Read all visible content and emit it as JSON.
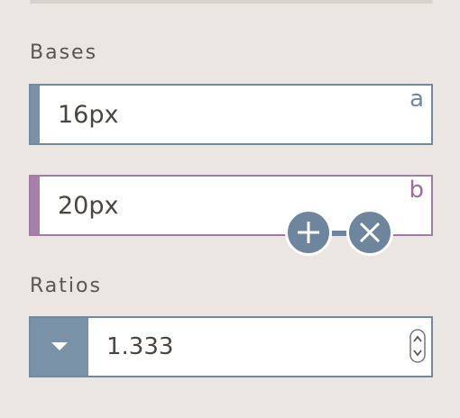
{
  "bases": {
    "label": "Bases",
    "fields": [
      {
        "letter": "a",
        "value": "16px",
        "color": "#6f8aa2"
      },
      {
        "letter": "b",
        "value": "20px",
        "color": "#a47aa8"
      }
    ],
    "add_icon": "plus-icon",
    "remove_icon": "close-icon"
  },
  "ratios": {
    "label": "Ratios",
    "value": "1.333",
    "dropdown_icon": "caret-down-icon",
    "spinner_icon": "spinner-arrows-icon"
  },
  "colors": {
    "background": "#ebe6e1",
    "accent_blue": "#6e869d",
    "accent_purple": "#a47aa8"
  }
}
